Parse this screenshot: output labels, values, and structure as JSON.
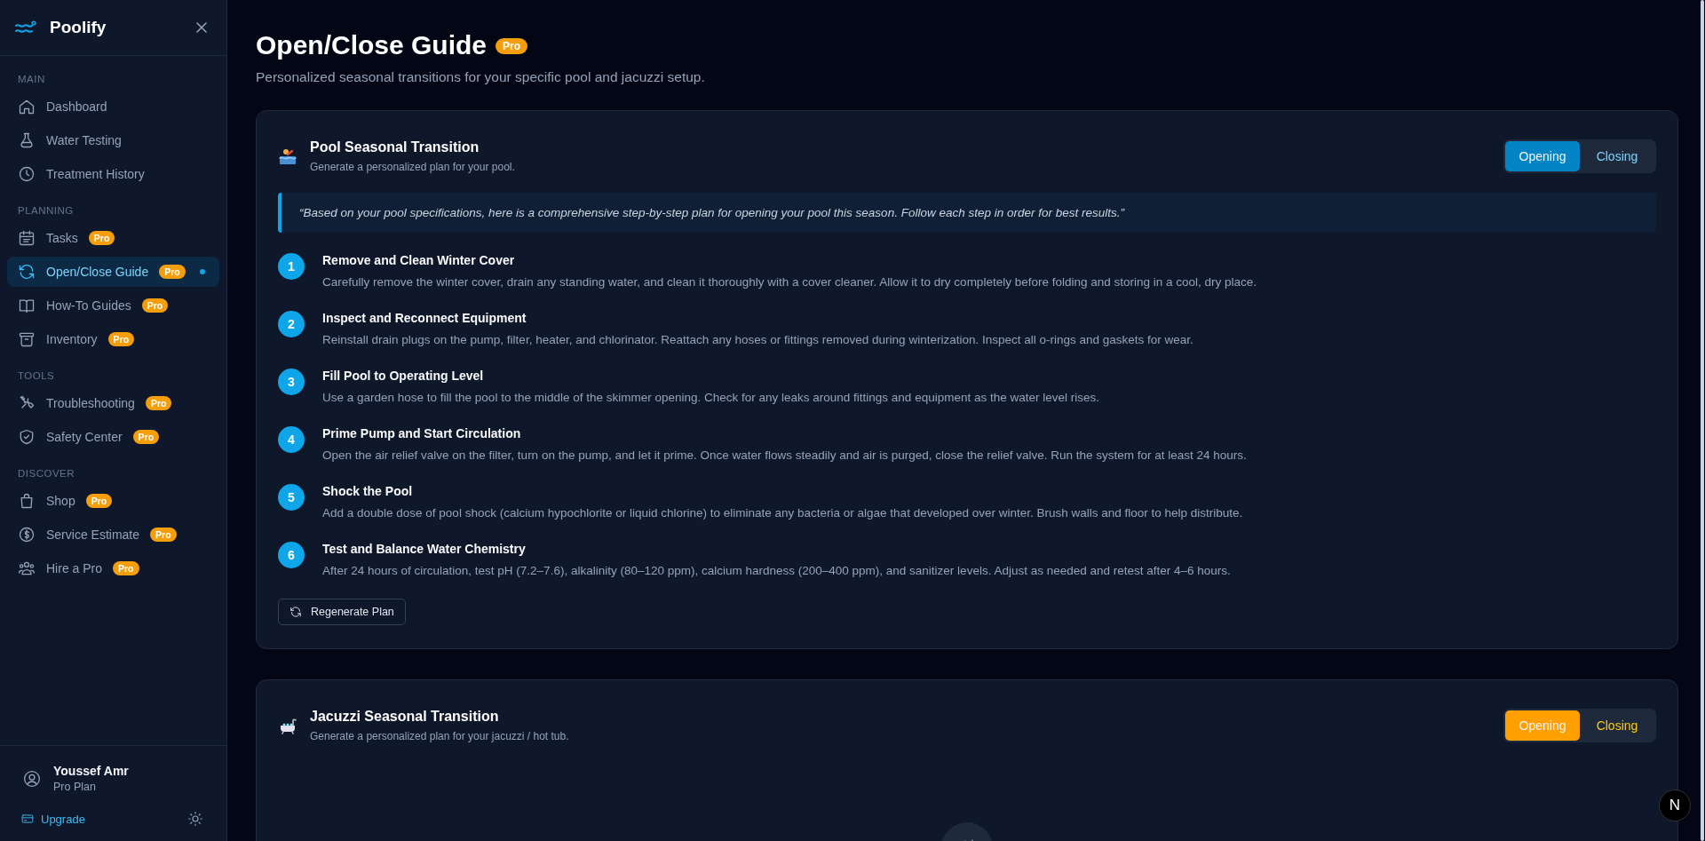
{
  "sidebar": {
    "brand": "Poolify",
    "sections": [
      {
        "label": "MAIN",
        "items": [
          {
            "label": "Dashboard",
            "selected": false
          },
          {
            "label": "Water Testing",
            "selected": false
          },
          {
            "label": "Treatment History",
            "selected": false
          }
        ]
      },
      {
        "label": "PLANNING",
        "items": [
          {
            "label": "Tasks",
            "badge": "Pro",
            "selected": false
          },
          {
            "label": "Open/Close Guide",
            "badge": "Pro",
            "selected": true
          },
          {
            "label": "How-To Guides",
            "badge": "Pro",
            "selected": false
          },
          {
            "label": "Inventory",
            "badge": "Pro",
            "selected": false
          }
        ]
      },
      {
        "label": "TOOLS",
        "items": [
          {
            "label": "Troubleshooting",
            "badge": "Pro",
            "selected": false
          },
          {
            "label": "Safety Center",
            "badge": "Pro",
            "selected": false
          }
        ]
      },
      {
        "label": "DISCOVER",
        "items": [
          {
            "label": "Shop",
            "badge": "Pro",
            "selected": false
          },
          {
            "label": "Service Estimate",
            "badge": "Pro",
            "selected": false
          },
          {
            "label": "Hire a Pro",
            "badge": "Pro",
            "selected": false
          }
        ]
      }
    ],
    "user": {
      "name": "Youssef Amr",
      "plan": "Pro Plan"
    },
    "upgrade": "Upgrade"
  },
  "page": {
    "title": "Open/Close Guide",
    "badge": "Pro",
    "subtitle": "Personalized seasonal transitions for your specific pool and jacuzzi setup."
  },
  "cards": [
    {
      "kind": "pool",
      "color": "#0284c7",
      "title": "Pool Seasonal Transition",
      "subtitle": "Generate a personalized plan for your pool.",
      "toggle": [
        {
          "label": "Opening",
          "selected": true
        },
        {
          "label": "Closing",
          "selected": false
        }
      ],
      "intro": "“Based on your pool specifications, here is a comprehensive step-by-step plan for opening your pool this season. Follow each step in order for best results.”",
      "steps": [
        {
          "number": "1",
          "title": "Remove and Clean Winter Cover",
          "text": "Carefully remove the winter cover, drain any standing water, and clean it thoroughly with a cover cleaner. Allow it to dry completely before folding and storing in a cool, dry place."
        },
        {
          "number": "2",
          "title": "Inspect and Reconnect Equipment",
          "text": "Reinstall drain plugs on the pump, filter, heater, and chlorinator. Reattach any hoses or fittings removed during winterization. Inspect all o-rings and gaskets for wear."
        },
        {
          "number": "3",
          "title": "Fill Pool to Operating Level",
          "text": "Use a garden hose to fill the pool to the middle of the skimmer opening. Check for any leaks around fittings and equipment as the water level rises."
        },
        {
          "number": "4",
          "title": "Prime Pump and Start Circulation",
          "text": "Open the air relief valve on the filter, turn on the pump, and let it prime. Once water flows steadily and air is purged, close the relief valve. Run the system for at least 24 hours."
        },
        {
          "number": "5",
          "title": "Shock the Pool",
          "text": "Add a double dose of pool shock (calcium hypochlorite or liquid chlorine) to eliminate any bacteria or algae that developed over winter. Brush walls and floor to help distribute."
        },
        {
          "number": "6",
          "title": "Test and Balance Water Chemistry",
          "text": "After 24 hours of circulation, test pH (7.2–7.6), alkalinity (80–120 ppm), calcium hardness (200–400 ppm), and sanitizer levels. Adjust as needed and retest after 4–6 hours."
        }
      ],
      "action": "Regenerate Plan"
    },
    {
      "kind": "jacuzzi",
      "color": "#ff9f00",
      "title": "Jacuzzi Seasonal Transition",
      "subtitle": "Generate a personalized plan for your jacuzzi / hot tub.",
      "toggle": [
        {
          "label": "Opening",
          "selected": true
        },
        {
          "label": "Closing",
          "selected": false
        }
      ]
    }
  ],
  "dev_badge": "N"
}
